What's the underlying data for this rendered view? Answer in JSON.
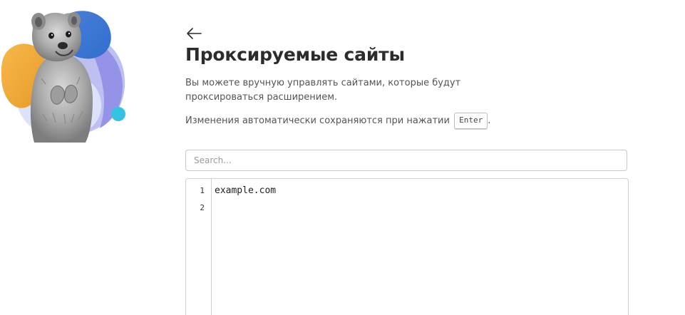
{
  "header": {
    "back_icon": "arrow-left-icon",
    "title": "Проксируемые сайты"
  },
  "description": "Вы можете вручную управлять сайтами, которые будут проксироваться расширением.",
  "autosave": {
    "text": "Изменения автоматически сохраняются при нажатии",
    "key": "Enter",
    "suffix": "."
  },
  "search": {
    "placeholder": "Search...",
    "value": ""
  },
  "editor": {
    "lines": [
      {
        "number": "1",
        "text": "example.com"
      },
      {
        "number": "2",
        "text": ""
      }
    ]
  },
  "mascot": {
    "icon": "quokka-mascot-icon",
    "colors": {
      "orange": "#f2a93b",
      "blue": "#3f7fd6",
      "purple": "#8f8ee6",
      "cyan": "#33c2e0"
    }
  }
}
